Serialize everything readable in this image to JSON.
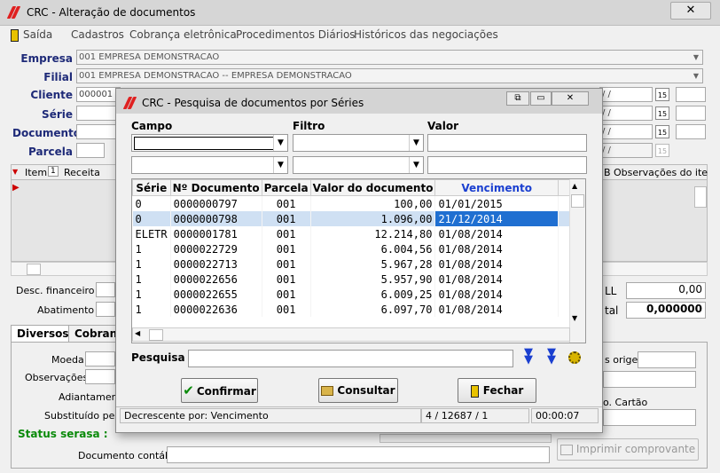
{
  "window": {
    "title": "CRC - Alteração de documentos",
    "close": "✕"
  },
  "menu": [
    "Saída",
    "Cadastros",
    "Cobrança eletrônica",
    "Procedimentos Diários",
    "Históricos das negociações"
  ],
  "form": {
    "empresa_label": "Empresa",
    "empresa_value": "001 EMPRESA DEMONSTRACAO",
    "filial_label": "Filial",
    "filial_value": "001 EMPRESA DEMONSTRACAO -- EMPRESA DEMONSTRACAO",
    "cliente_label": "Cliente",
    "cliente_value": "000001",
    "serie_label": "Série",
    "documento_label": "Documento",
    "parcela_label": "Parcela",
    "date_placeholder": "/ /"
  },
  "grid": {
    "col_item": "Item",
    "col_item_badge": "1",
    "col_receita": "Receita",
    "col_b": "B",
    "col_obs": "Observações do ite"
  },
  "totals": {
    "desc_financeiro": "Desc. financeiro",
    "abatimento": "Abatimento",
    "ll_label": "LL",
    "ll_value": "0,00",
    "total_label": "tal",
    "total_value": "0,000000"
  },
  "tabs": [
    "Diversos",
    "Cobranç"
  ],
  "panel": {
    "moeda": "Moeda",
    "observacoes": "Observações",
    "adiantamento": "Adiantamento",
    "substituido": "Substituído pelo",
    "status_serasa": "Status serasa :",
    "documento_contabil": "Documento contábil",
    "origem": "s origem",
    "cartao": "o. Cartão",
    "imprimir": "Imprimir comprovante"
  },
  "dialog": {
    "title": "CRC - Pesquisa de documentos por Séries",
    "campo": "Campo",
    "filtro": "Filtro",
    "valor": "Valor",
    "headers": [
      "Série",
      "Nº Documento",
      "Parcela",
      "Valor do documento",
      "Vencimento"
    ],
    "rows": [
      [
        "0",
        "0000000797",
        "001",
        "100,00",
        "01/01/2015"
      ],
      [
        "0",
        "0000000798",
        "001",
        "1.096,00",
        "21/12/2014"
      ],
      [
        "ELETR",
        "0000001781",
        "001",
        "12.214,80",
        "01/08/2014"
      ],
      [
        "1",
        "0000022729",
        "001",
        "6.004,56",
        "01/08/2014"
      ],
      [
        "1",
        "0000022713",
        "001",
        "5.967,28",
        "01/08/2014"
      ],
      [
        "1",
        "0000022656",
        "001",
        "5.957,90",
        "01/08/2014"
      ],
      [
        "1",
        "0000022655",
        "001",
        "6.009,25",
        "01/08/2014"
      ],
      [
        "1",
        "0000022636",
        "001",
        "6.097,70",
        "01/08/2014"
      ]
    ],
    "selected_row": 1,
    "pesquisa": "Pesquisa",
    "confirmar": "Confirmar",
    "consultar": "Consultar",
    "fechar": "Fechar",
    "status_sort": "Decrescente por: Vencimento",
    "status_count": "4 / 12687 / 1",
    "status_time": "00:00:07"
  },
  "colors": {
    "label_blue": "#1e2a78",
    "selection": "#1f6fd1",
    "status_green": "#0a8a0a",
    "sort_arrow": "#1a3fd0"
  }
}
